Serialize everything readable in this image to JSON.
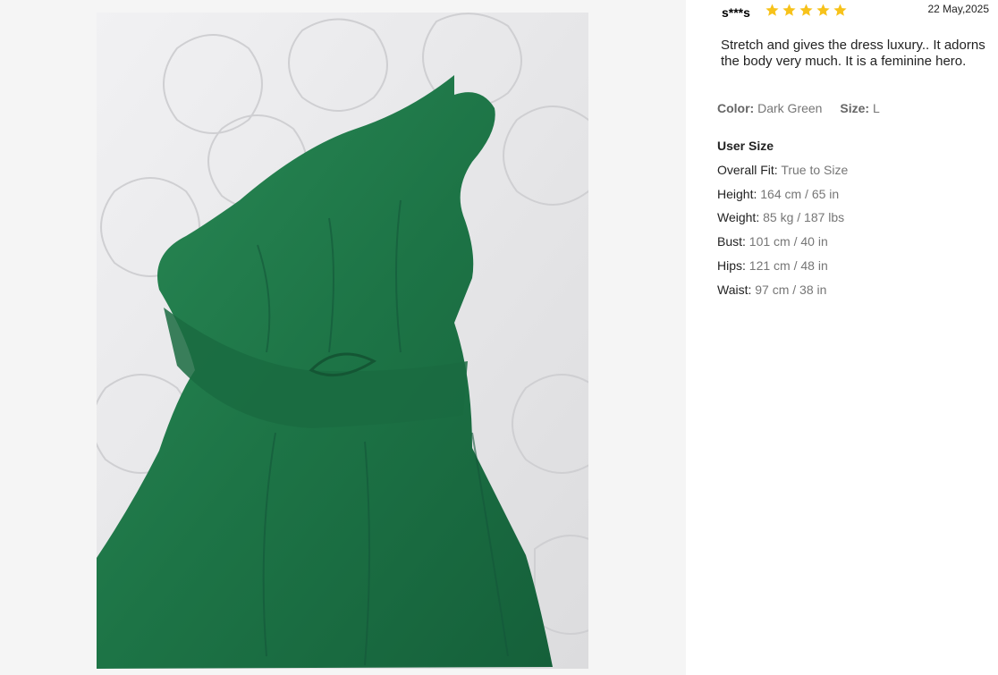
{
  "photo": {
    "alt_icon": "product-photo",
    "description_colors": {
      "dress": "#1f7a4a",
      "bedding": "#e8e8ea"
    }
  },
  "review": {
    "reviewer": "s***s",
    "rating": 5,
    "star_color": "#f7c21a",
    "date": "22 May,2025",
    "text": "Stretch and gives the dress luxury.. It adorns the body very much. It is a feminine hero.",
    "color_label": "Color:",
    "color_value": "Dark Green",
    "size_label": "Size:",
    "size_value": "L",
    "user_size": {
      "title": "User Size",
      "rows": [
        {
          "label": "Overall Fit:",
          "value": "True to Size"
        },
        {
          "label": "Height:",
          "value": "164 cm / 65 in"
        },
        {
          "label": "Weight:",
          "value": "85 kg / 187 lbs"
        },
        {
          "label": "Bust:",
          "value": "101 cm / 40 in"
        },
        {
          "label": "Hips:",
          "value": "121 cm / 48 in"
        },
        {
          "label": "Waist:",
          "value": "97 cm / 38 in"
        }
      ]
    }
  }
}
